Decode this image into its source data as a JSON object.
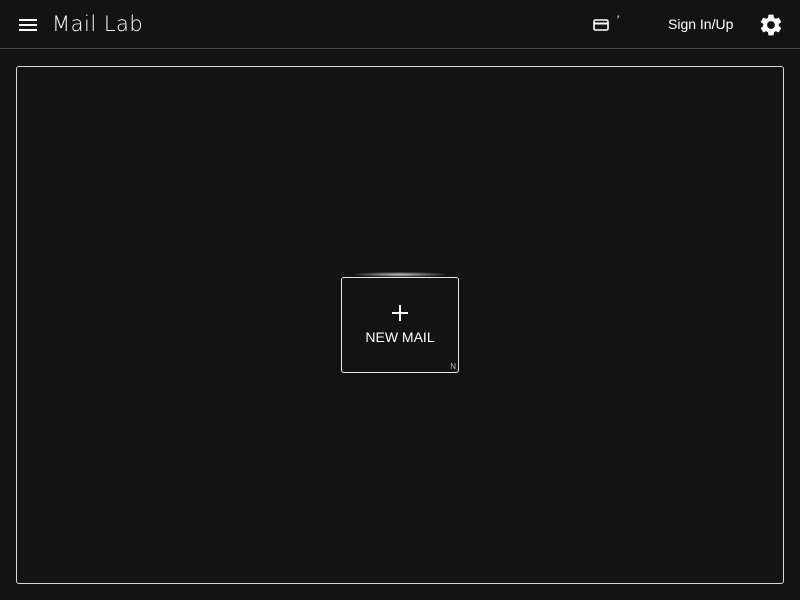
{
  "header": {
    "app_title": "Mail Lab",
    "menu_icon": "hamburger-menu-icon",
    "card_icon": "credit-card-icon",
    "credit_value": "′",
    "signin_label": "Sign In/Up",
    "settings_icon": "gear-icon"
  },
  "main": {
    "new_mail_label": "NEW MAIL",
    "new_mail_shortcut": "N",
    "plus_icon": "plus-icon"
  },
  "colors": {
    "background": "#131313",
    "text": "#ffffff",
    "border": "#d8d8d8",
    "divider": "#4a4a4a"
  }
}
